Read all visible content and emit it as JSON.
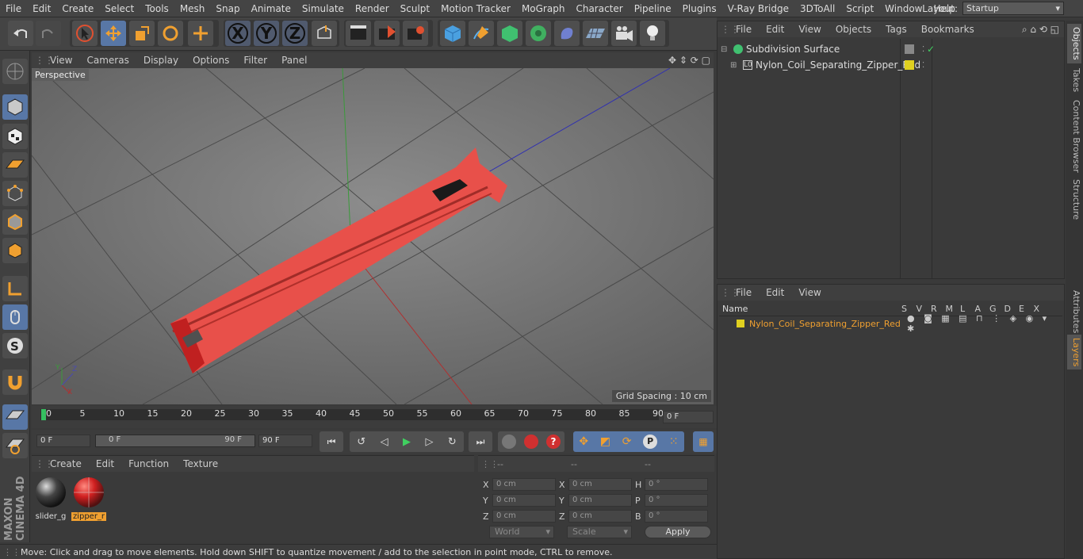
{
  "menubar": {
    "items": [
      "File",
      "Edit",
      "Create",
      "Select",
      "Tools",
      "Mesh",
      "Snap",
      "Animate",
      "Simulate",
      "Render",
      "Sculpt",
      "Motion Tracker",
      "MoGraph",
      "Character",
      "Pipeline",
      "Plugins",
      "V-Ray Bridge",
      "3DToAll",
      "Script",
      "Window",
      "Help"
    ],
    "layout_label": "Layout:",
    "layout_value": "Startup"
  },
  "viewport": {
    "menu": [
      "View",
      "Cameras",
      "Display",
      "Options",
      "Filter",
      "Panel"
    ],
    "camera_label": "Perspective",
    "grid_spacing": "Grid Spacing : 10 cm"
  },
  "timeline": {
    "ticks": [
      "0",
      "5",
      "10",
      "15",
      "20",
      "25",
      "30",
      "35",
      "40",
      "45",
      "50",
      "55",
      "60",
      "65",
      "70",
      "75",
      "80",
      "85",
      "90"
    ],
    "current_frame": "0 F"
  },
  "transport": {
    "start": "0 F",
    "range_start": "0 F",
    "range_end": "90 F",
    "end": "90 F"
  },
  "materials": {
    "menu": [
      "Create",
      "Edit",
      "Function",
      "Texture"
    ],
    "items": [
      {
        "name": "slider_g"
      },
      {
        "name": "zipper_r"
      }
    ]
  },
  "coords": {
    "headers": [
      "--",
      "--",
      "--"
    ],
    "rows": [
      {
        "a": "X",
        "av": "0 cm",
        "b": "X",
        "bv": "0 cm",
        "c": "H",
        "cv": "0 °"
      },
      {
        "a": "Y",
        "av": "0 cm",
        "b": "Y",
        "bv": "0 cm",
        "c": "P",
        "cv": "0 °"
      },
      {
        "a": "Z",
        "av": "0 cm",
        "b": "Z",
        "bv": "0 cm",
        "c": "B",
        "cv": "0 °"
      }
    ],
    "world": "World",
    "scale": "Scale",
    "apply": "Apply"
  },
  "status": "Move: Click and drag to move elements. Hold down SHIFT to quantize movement / add to the selection in point mode, CTRL to remove.",
  "objects": {
    "menu": [
      "File",
      "Edit",
      "View",
      "Objects",
      "Tags",
      "Bookmarks"
    ],
    "items": [
      "Subdivision Surface",
      "Nylon_Coil_Separating_Zipper_Red"
    ]
  },
  "layers": {
    "menu": [
      "File",
      "Edit",
      "View"
    ],
    "name_header": "Name",
    "cols": [
      "S",
      "V",
      "R",
      "M",
      "L",
      "A",
      "G",
      "D",
      "E",
      "X"
    ],
    "item": "Nylon_Coil_Separating_Zipper_Red"
  },
  "rtabs": [
    "Objects",
    "Takes",
    "Content Browser",
    "Structure",
    "Attributes",
    "Layers"
  ],
  "brand": "MAXON CINEMA 4D"
}
